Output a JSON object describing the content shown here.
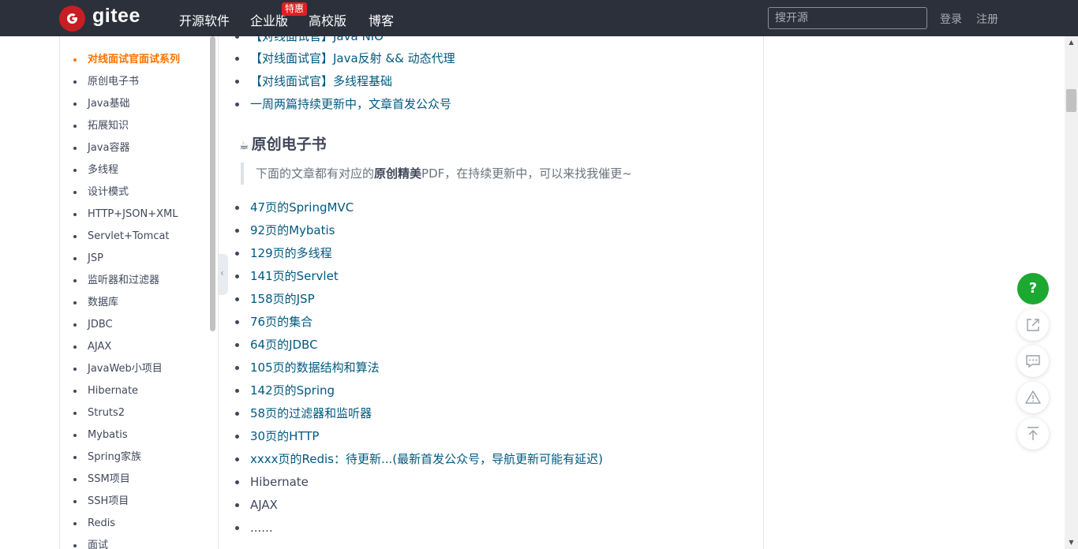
{
  "header": {
    "logo_text": "gitee",
    "nav": [
      "开源软件",
      "企业版",
      "高校版",
      "博客"
    ],
    "badge": "特惠",
    "search_placeholder": "搜开源",
    "login": "登录",
    "register": "注册"
  },
  "sidebar": {
    "items": [
      "对线面试官面试系列",
      "原创电子书",
      "Java基础",
      "拓展知识",
      "Java容器",
      "多线程",
      "设计模式",
      "HTTP+JSON+XML",
      "Servlet+Tomcat",
      "JSP",
      "监听器和过滤器",
      "数据库",
      "JDBC",
      "AJAX",
      "JavaWeb小项目",
      "Hibernate",
      "Struts2",
      "Mybatis",
      "Spring家族",
      "SSM项目",
      "SSH项目",
      "Redis",
      "面试"
    ]
  },
  "content": {
    "top_list": [
      "【对线面试官】Java NIO",
      "【对线面试官】Java反射 && 动态代理",
      "【对线面试官】多线程基础",
      "一周两篇持续更新中，文章首发公众号"
    ],
    "heading_icon": "☕",
    "heading": "原创电子书",
    "quote_pre": "下面的文章都有对应的",
    "quote_bold": "原创精美",
    "quote_post": "PDF，在持续更新中，可以来找我催更~",
    "books": [
      "47页的SpringMVC",
      "92页的Mybatis",
      "129页的多线程",
      "141页的Servlet",
      "158页的JSP",
      "76页的集合",
      "64页的JDBC",
      "105页的数据结构和算法",
      "142页的Spring",
      "58页的过滤器和监听器",
      "30页的HTTP",
      "xxxx页的Redis：待更新...(最新首发公众号，导航更新可能有延迟)",
      "Hibernate",
      "AJAX",
      "......"
    ]
  },
  "floating": {
    "help": "?"
  },
  "colors": {
    "header_bg": "#2b303b",
    "accent": "#fe7300",
    "link": "#005980",
    "brand": "#c71d23",
    "help_green": "#1da831"
  }
}
